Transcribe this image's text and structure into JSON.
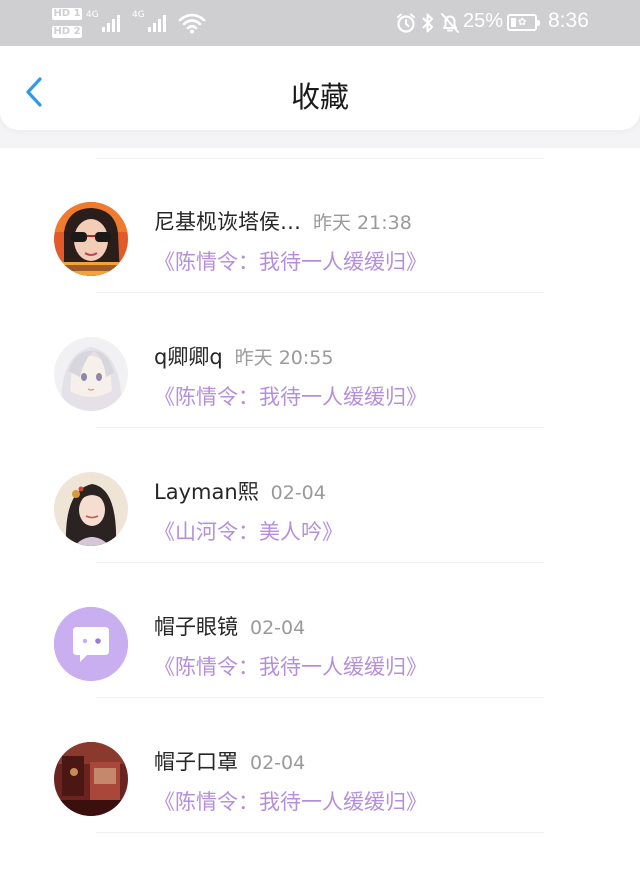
{
  "status_bar": {
    "hd_1": "HD 1",
    "hd_2": "HD 2",
    "net_1": "4G",
    "net_2": "4G",
    "battery_percent": "25%",
    "time": "8:36",
    "icons": [
      "alarm-icon",
      "bluetooth-icon",
      "mute-icon",
      "wifi-icon",
      "battery-icon"
    ]
  },
  "header": {
    "back_icon": "chevron-left-icon",
    "title": "收藏",
    "accent_color": "#2f9be8"
  },
  "favorites": [
    {
      "username": "尼基枧诙塔侯…",
      "time": "昨天 21:38",
      "work": "《陈情令：我待一人缓缓归》",
      "avatar": "photo-avatar-sunglasses"
    },
    {
      "username": "q卿卿q",
      "time": "昨天 20:55",
      "work": "《陈情令：我待一人缓缓归》",
      "avatar": "anime-avatar-white-hair"
    },
    {
      "username": "Layman熙",
      "time": "02-04",
      "work": "《山河令：美人吟》",
      "avatar": "illustration-avatar-ancient-lady"
    },
    {
      "username": "帽子眼镜",
      "time": "02-04",
      "work": "《陈情令：我待一人缓缓归》",
      "avatar": "default-chat-avatar"
    },
    {
      "username": "帽子口罩",
      "time": "02-04",
      "work": "《陈情令：我待一人缓缓归》",
      "avatar": "photo-avatar-red-room"
    }
  ],
  "colors": {
    "work_title": "#b58fdc",
    "username": "#262626",
    "time": "#9a9a9a",
    "default_avatar_bg": "#c9aef0"
  }
}
